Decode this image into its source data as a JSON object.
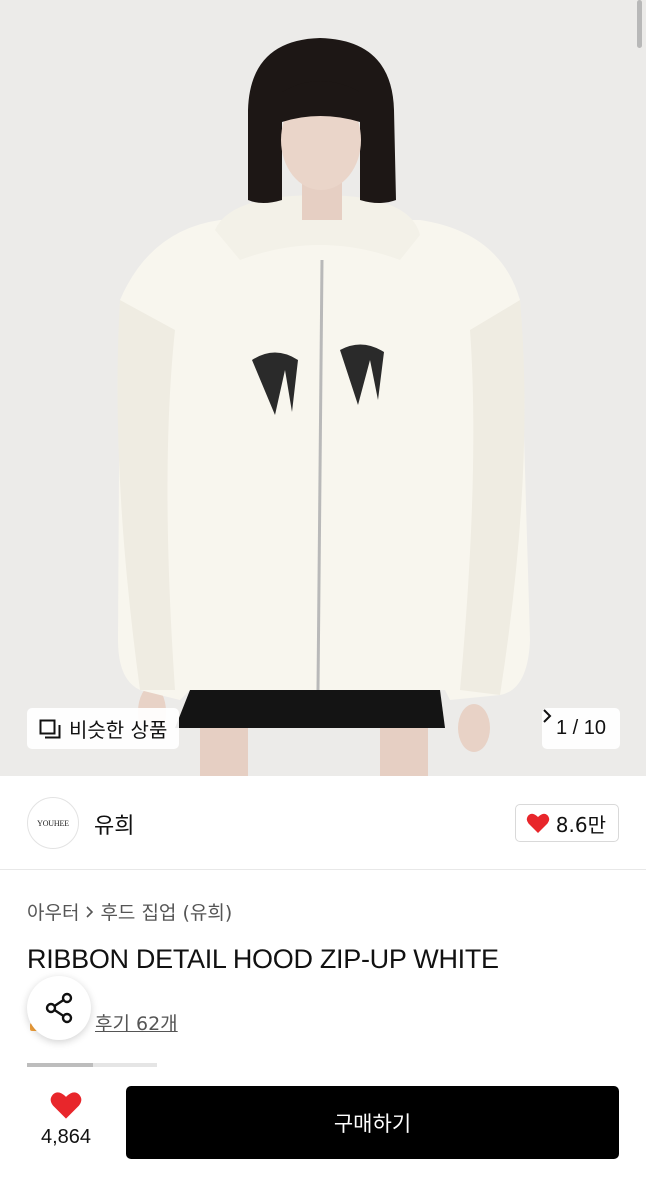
{
  "gallery": {
    "similar_label": "비슷한 상품",
    "counter": "1 / 10",
    "icons": {
      "similar": "similar-products-icon",
      "next": "chevron-right-icon"
    }
  },
  "brand": {
    "logo_text": "YOUHEE",
    "name": "유희",
    "likes": "8.6만",
    "heart_color": "#e8262b"
  },
  "product": {
    "breadcrumb": [
      "아우터",
      "후드 집업 (유희)"
    ],
    "title": "RIBBON DETAIL HOOD ZIP-UP WHITE",
    "review_link": "후기 62개"
  },
  "bottom_bar": {
    "like_count": "4,864",
    "buy_label": "구매하기"
  }
}
